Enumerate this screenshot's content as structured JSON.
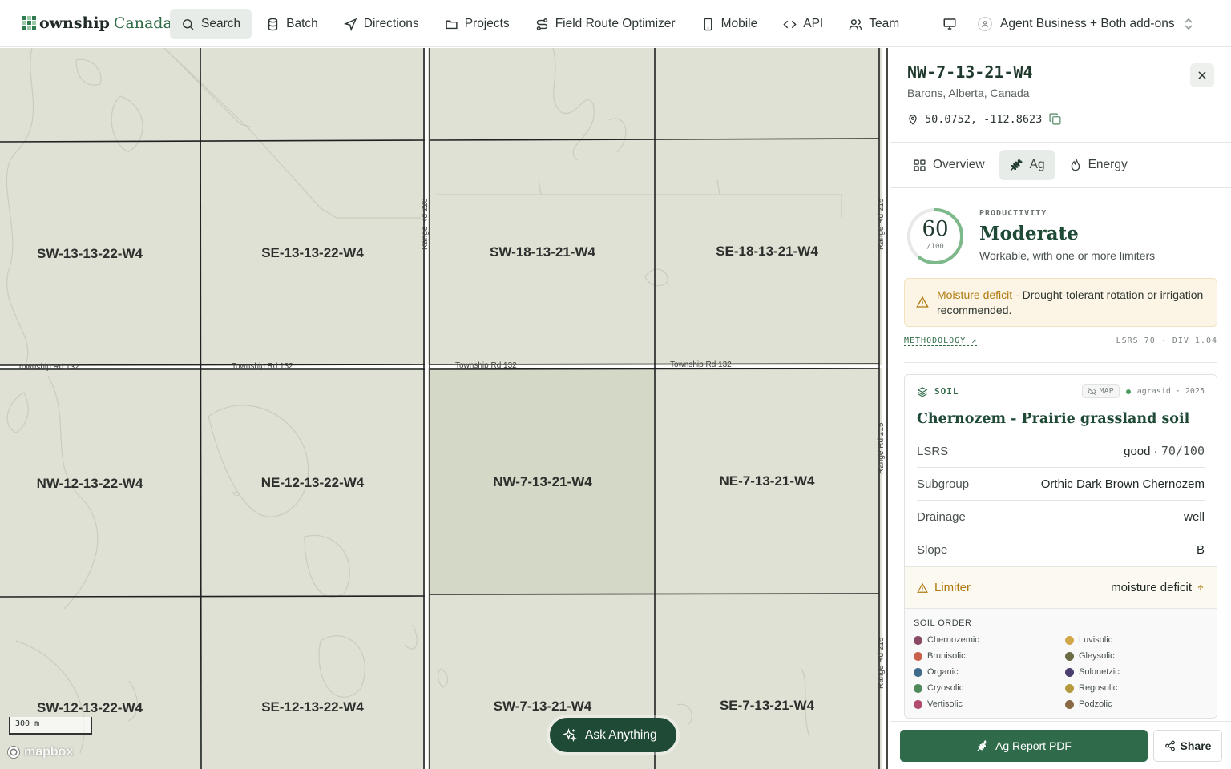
{
  "app": {
    "logo_main": "ownship",
    "logo_suffix": "Canada"
  },
  "nav": {
    "items": [
      {
        "label": "Search",
        "icon": "search-icon",
        "active": true
      },
      {
        "label": "Batch",
        "icon": "database-icon"
      },
      {
        "label": "Directions",
        "icon": "navigation-icon"
      },
      {
        "label": "Projects",
        "icon": "folder-icon"
      },
      {
        "label": "Field Route Optimizer",
        "icon": "route-icon"
      },
      {
        "label": "Mobile",
        "icon": "phone-icon"
      },
      {
        "label": "API",
        "icon": "code-icon"
      },
      {
        "label": "Team",
        "icon": "users-icon"
      }
    ]
  },
  "account": {
    "label": "Agent Business + Both add-ons"
  },
  "map": {
    "parcels": [
      "SW-13-13-22-W4",
      "SE-13-13-22-W4",
      "SW-18-13-21-W4",
      "SE-18-13-21-W4",
      "NW-12-13-22-W4",
      "NE-12-13-22-W4",
      "NW-7-13-21-W4",
      "NE-7-13-21-W4",
      "SW-12-13-22-W4",
      "SE-12-13-22-W4",
      "SW-7-13-21-W4",
      "SE-7-13-21-W4"
    ],
    "road_h": "Township Rd 132",
    "road_v1": "Range Rd 220",
    "road_v2": "Range Rd 215",
    "scale": "300 m",
    "attribution": "mapbox",
    "ask_label": "Ask Anything"
  },
  "panel": {
    "title": "NW-7-13-21-W4",
    "location": "Barons, Alberta, Canada",
    "coords": "50.0752, -112.8623",
    "tabs": [
      {
        "label": "Overview",
        "icon": "grid-icon"
      },
      {
        "label": "Ag",
        "icon": "wheat-icon",
        "active": true
      },
      {
        "label": "Energy",
        "icon": "flame-icon"
      }
    ],
    "productivity": {
      "score": "60",
      "max": "/100",
      "score_value": 60,
      "kicker": "PRODUCTIVITY",
      "rating": "Moderate",
      "description": "Workable, with one or more limiters"
    },
    "alert": {
      "title": "Moisture deficit",
      "text": " - Drought-tolerant rotation or irrigation recommended."
    },
    "methodology": {
      "link": "METHODOLOGY ↗",
      "meta": "LSRS 70 · DIV 1.04"
    },
    "soil": {
      "label": "SOIL",
      "map_badge": "MAP",
      "source": "agrasid · 2025",
      "title": "Chernozem - Prairie grassland soil",
      "rows": [
        {
          "key": "LSRS",
          "value": "good · ",
          "value_mono": "70/100"
        },
        {
          "key": "Subgroup",
          "value": "Orthic Dark Brown Chernozem"
        },
        {
          "key": "Drainage",
          "value": "well"
        },
        {
          "key": "Slope",
          "value": "B"
        }
      ],
      "limiter": {
        "key": "Limiter",
        "value": "moisture deficit"
      },
      "order_title": "SOIL ORDER",
      "orders": [
        {
          "name": "Chernozemic",
          "color": "#8a4a66"
        },
        {
          "name": "Luvisolic",
          "color": "#d1a74a"
        },
        {
          "name": "Brunisolic",
          "color": "#c8604a"
        },
        {
          "name": "Gleysolic",
          "color": "#6b6b44"
        },
        {
          "name": "Organic",
          "color": "#3f6a8a"
        },
        {
          "name": "Solonetzic",
          "color": "#4a3e6e"
        },
        {
          "name": "Cryosolic",
          "color": "#4f8a5a"
        },
        {
          "name": "Regosolic",
          "color": "#b59a3e"
        },
        {
          "name": "Vertisolic",
          "color": "#b04a6e"
        },
        {
          "name": "Podzolic",
          "color": "#8a6a44"
        }
      ]
    },
    "footer": {
      "pdf_label": "Ag Report PDF",
      "share_label": "Share"
    }
  }
}
